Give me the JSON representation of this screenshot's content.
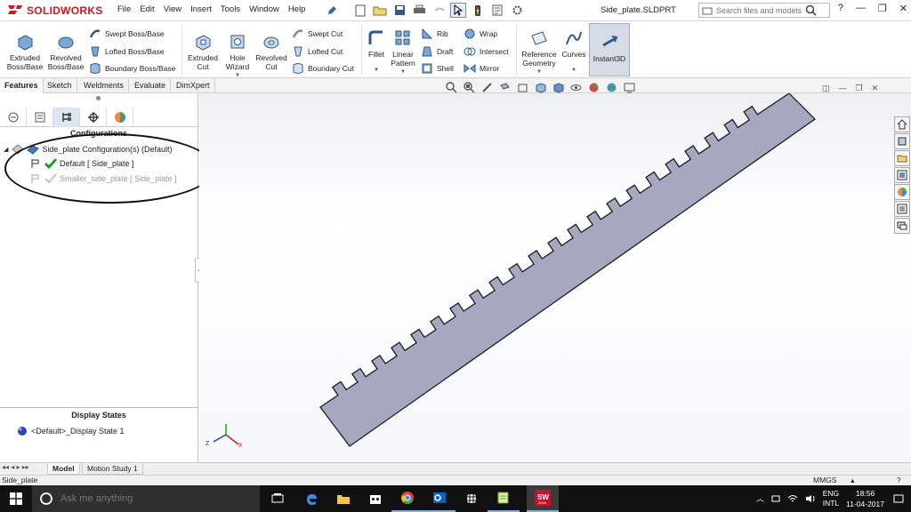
{
  "app": {
    "logo_text": "SOLIDWORKS",
    "document_title": "Side_plate.SLDPRT",
    "menu": [
      "File",
      "Edit",
      "View",
      "Insert",
      "Tools",
      "Window",
      "Help"
    ],
    "search": {
      "placeholder": "Search files and models"
    },
    "help_label": "?"
  },
  "ribbon": {
    "extruded_boss": "Extruded Boss/Base",
    "revolved_boss": "Revolved Boss/Base",
    "swept_boss": "Swept Boss/Base",
    "lofted_boss": "Lofted Boss/Base",
    "boundary_boss": "Boundary Boss/Base",
    "extruded_cut": "Extruded Cut",
    "hole_wizard": "Hole Wizard",
    "revolved_cut": "Revolved Cut",
    "swept_cut": "Swept Cut",
    "lofted_cut": "Lofted Cut",
    "boundary_cut": "Boundary Cut",
    "fillet": "Fillet",
    "linear_pattern": "Linear Pattern",
    "rib": "Rib",
    "draft": "Draft",
    "shell": "Shell",
    "wrap": "Wrap",
    "intersect": "Intersect",
    "mirror": "Mirror",
    "reference_geometry": "Reference Geometry",
    "curves": "Curves",
    "instant3d": "Instant3D"
  },
  "tabs": [
    "Features",
    "Sketch",
    "Weldments",
    "Evaluate",
    "DimXpert"
  ],
  "configurations": {
    "title": "Configurations",
    "root": "Side_plate Configuration(s)  (Default)",
    "items": [
      {
        "label": "Default [ Side_plate ]",
        "active": true
      },
      {
        "label": "Smaller_side_plate [ Side_plate ]",
        "active": false
      }
    ]
  },
  "display_states": {
    "title": "Display States",
    "items": [
      "<Default>_Display State 1"
    ]
  },
  "bottom_tabs": [
    "Model",
    "Motion Study 1"
  ],
  "status": {
    "left": "Side_plate",
    "units": "MMGS"
  },
  "taskbar": {
    "search_placeholder": "Ask me anything",
    "lang_1": "ENG",
    "lang_2": "INTL",
    "time": "18:56",
    "date": "11-04-2017"
  },
  "colors": {
    "part_fill": "#a6a8c0",
    "brand_red": "#d4171e",
    "taskbar": "#111111"
  },
  "icons": [
    "solidworks-logo",
    "pin-icon",
    "new-doc-icon",
    "open-icon",
    "save-icon",
    "print-icon",
    "undo-icon",
    "select-icon",
    "rebuild-icon",
    "options-icon",
    "search-icon"
  ]
}
